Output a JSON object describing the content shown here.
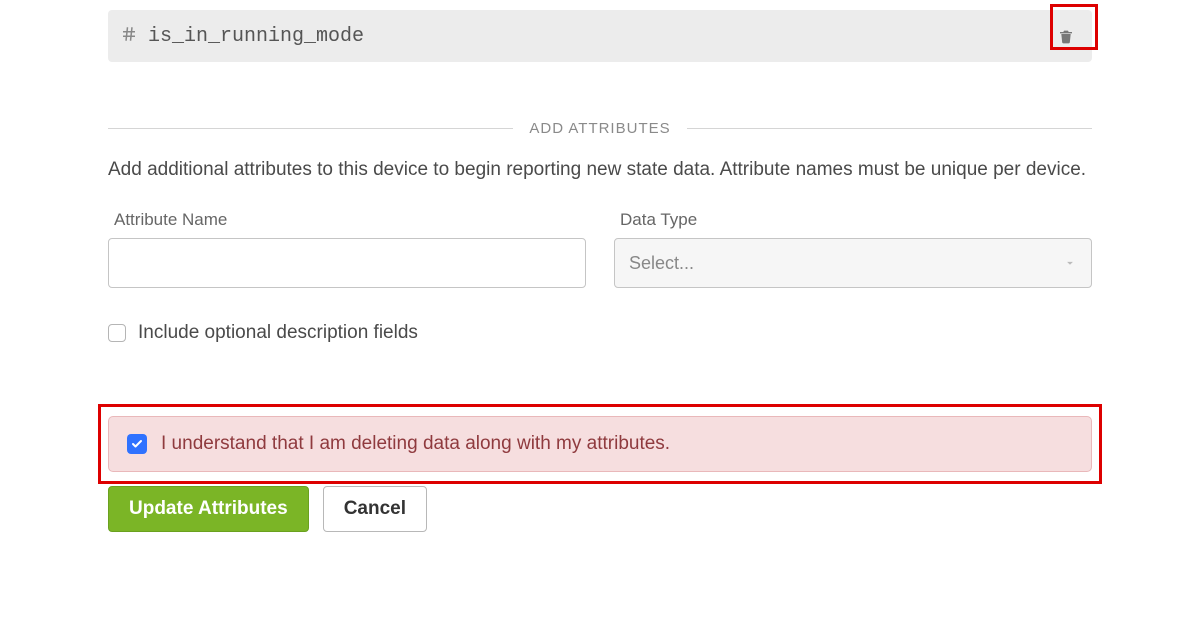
{
  "attribute": {
    "name": "is_in_running_mode",
    "type_symbol": "#"
  },
  "section": {
    "heading": "ADD ATTRIBUTES",
    "description": "Add additional attributes to this device to begin reporting new state data. Attribute names must be unique per device."
  },
  "form": {
    "name_label": "Attribute Name",
    "name_value": "",
    "type_label": "Data Type",
    "type_selected": "Select..."
  },
  "optional": {
    "label": "Include optional description fields",
    "checked": false
  },
  "warning": {
    "label": "I understand that I am deleting data along with my attributes.",
    "checked": true
  },
  "actions": {
    "update": "Update Attributes",
    "cancel": "Cancel"
  },
  "highlights": {
    "trash": true,
    "warn": true
  }
}
